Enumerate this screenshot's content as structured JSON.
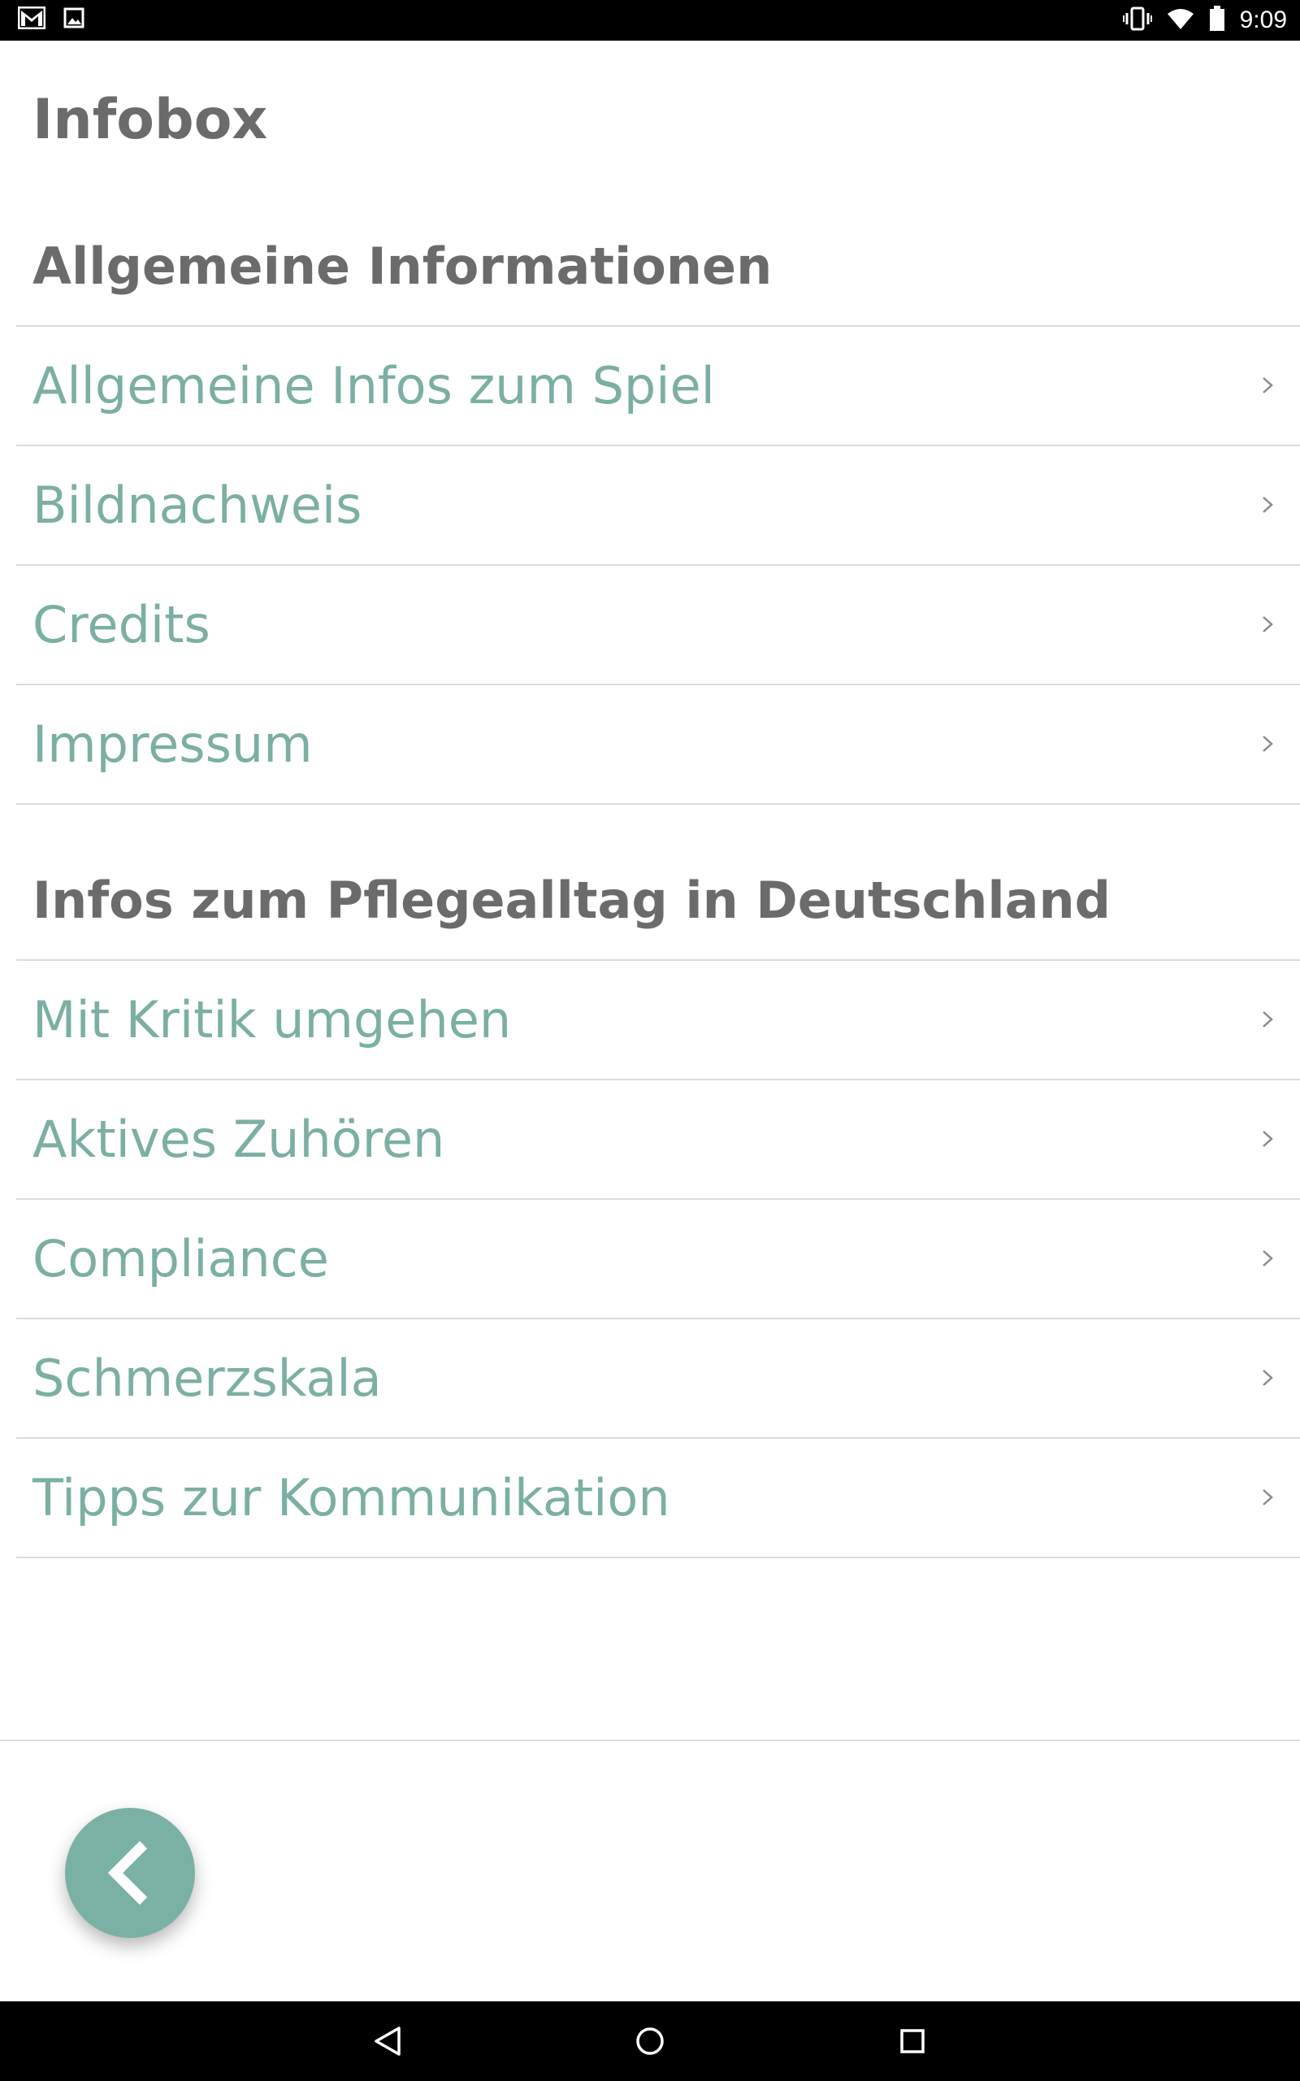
{
  "status_bar": {
    "time": "9:09",
    "icons": [
      "gmail-icon",
      "image-icon",
      "vibrate-icon",
      "wifi-icon",
      "battery-icon"
    ]
  },
  "page": {
    "title": "Infobox"
  },
  "sections": [
    {
      "header": "Allgemeine Informationen",
      "items": [
        {
          "label": "Allgemeine Infos zum Spiel"
        },
        {
          "label": "Bildnachweis"
        },
        {
          "label": "Credits"
        },
        {
          "label": "Impressum"
        }
      ]
    },
    {
      "header": "Infos zum Pflegealltag in Deutschland",
      "items": [
        {
          "label": "Mit Kritik umgehen"
        },
        {
          "label": "Aktives Zuhören"
        },
        {
          "label": "Compliance"
        },
        {
          "label": "Schmerzskala"
        },
        {
          "label": "Tipps zur Kommunikation"
        }
      ]
    }
  ],
  "fab": {
    "icon": "chevron-left-icon"
  },
  "nav_bar": {
    "icons": [
      "nav-back-icon",
      "nav-home-icon",
      "nav-recents-icon"
    ]
  },
  "colors": {
    "accent": "#7cafa4",
    "heading": "#6b6b6b",
    "divider": "#dcdcdc"
  }
}
